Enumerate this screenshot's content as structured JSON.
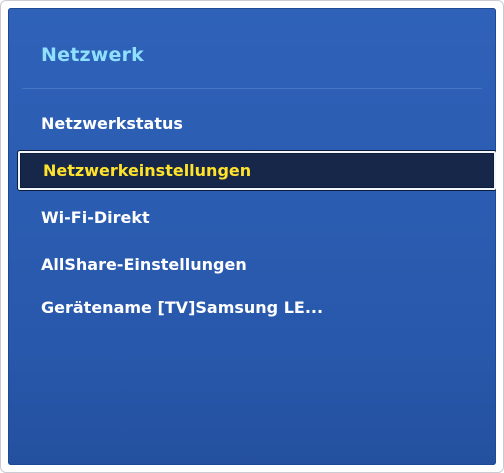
{
  "panel": {
    "title": "Netzwerk"
  },
  "menu": {
    "items": [
      {
        "label": "Netzwerkstatus",
        "selected": false
      },
      {
        "label": "Netzwerkeinstellungen",
        "selected": true
      },
      {
        "label": "Wi-Fi-Direkt",
        "selected": false
      },
      {
        "label": "AllShare-Einstellungen",
        "selected": false
      },
      {
        "label": "Gerätename  [TV]Samsung LE...",
        "selected": false
      }
    ]
  },
  "colors": {
    "panel_background": "#2a5cb1",
    "title_color": "#8fe0ff",
    "item_text": "#ffffff",
    "selected_background": "#16274a",
    "selected_text": "#ffe22c",
    "selected_border": "#f2f6ff"
  }
}
